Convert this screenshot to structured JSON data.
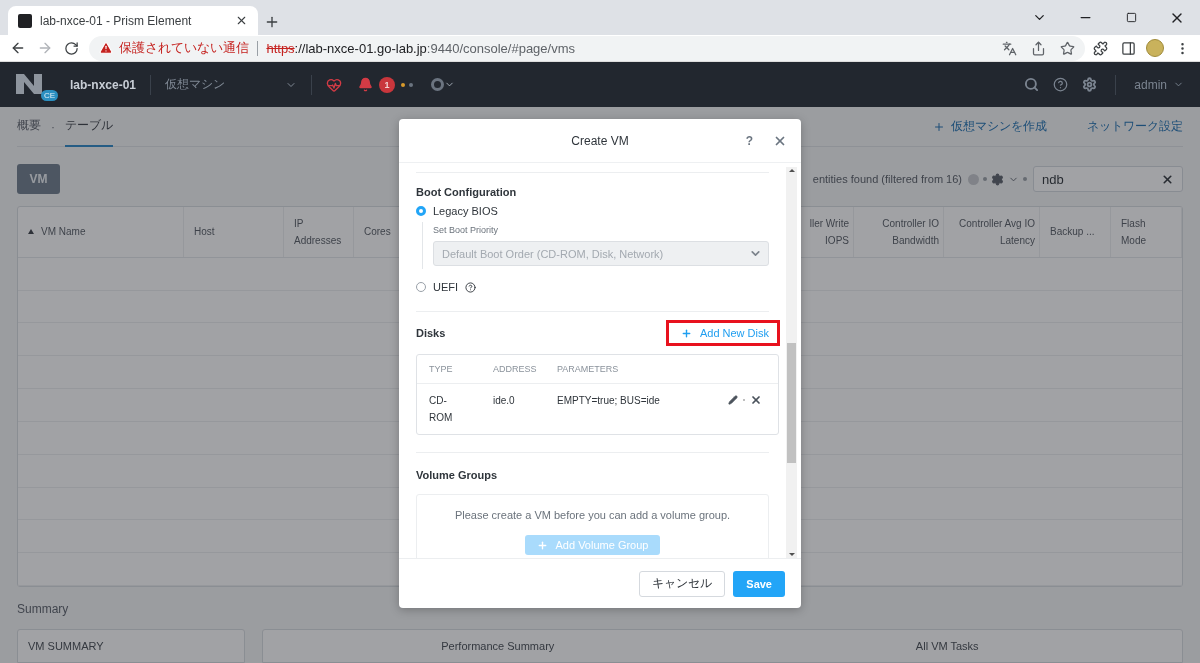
{
  "browser": {
    "tab_title": "lab-nxce-01 - Prism Element",
    "security_label": "保護されていない通信",
    "url": {
      "scheme": "https",
      "host": "://lab-nxce-01.go-lab.jp",
      "path": ":9440/console/#page/vms"
    }
  },
  "app_header": {
    "logo_badge": "CE",
    "cluster": "lab-nxce-01",
    "view_menu": "仮想マシン",
    "alert_count": "1",
    "user": "admin"
  },
  "subnav": {
    "tabs": [
      {
        "label": "概要",
        "selected": false
      },
      {
        "label": "テーブル",
        "selected": true
      }
    ],
    "separator": "·",
    "create_vm": "仮想マシンを作成",
    "network": "ネットワーク設定"
  },
  "toolbar": {
    "view_button": "VM",
    "result_text": "entities found (filtered from 16)",
    "search": {
      "value": "ndb"
    }
  },
  "table": {
    "columns_left": [
      {
        "label": "VM Name",
        "sorted": true,
        "kind": "text"
      },
      {
        "label": "Host",
        "sorted": false,
        "kind": "text"
      },
      {
        "label": "IP Addresses",
        "sorted": false,
        "kind": "text"
      },
      {
        "label": "Cores",
        "sorted": false,
        "kind": "text"
      }
    ],
    "columns_right": [
      {
        "label": "ller Write IOPS",
        "sorted": false,
        "kind": "metric"
      },
      {
        "label": "Controller IO Bandwidth",
        "sorted": false,
        "kind": "metric"
      },
      {
        "label": "Controller Avg IO Latency",
        "sorted": false,
        "kind": "metric"
      },
      {
        "label": "Backup ...",
        "sorted": false,
        "kind": "text"
      },
      {
        "label": "Flash Mode",
        "sorted": false,
        "kind": "text"
      }
    ]
  },
  "summary": {
    "title": "Summary",
    "vm_summary": "VM SUMMARY",
    "performance": "Performance Summary",
    "tasks": "All VM Tasks"
  },
  "dialog": {
    "title": "Create VM",
    "help": "?",
    "boot": {
      "heading": "Boot Configuration",
      "options": [
        {
          "label": "Legacy BIOS",
          "selected": true,
          "help": false
        },
        {
          "label": "UEFI",
          "selected": false,
          "help": true
        }
      ],
      "priority_label": "Set Boot Priority",
      "priority_value": "Default Boot Order (CD-ROM, Disk, Network)"
    },
    "disks": {
      "heading": "Disks",
      "add_label": "Add New Disk",
      "columns": [
        "TYPE",
        "ADDRESS",
        "PARAMETERS"
      ],
      "rows": [
        {
          "type": "CD-ROM",
          "address": "ide.0",
          "parameters": "EMPTY=true; BUS=ide"
        }
      ]
    },
    "volume_groups": {
      "heading": "Volume Groups",
      "message": "Please create a VM before you can add a volume group.",
      "add_label": "Add Volume Group",
      "disabled": true
    },
    "cancel": "キャンセル",
    "save": "Save"
  }
}
